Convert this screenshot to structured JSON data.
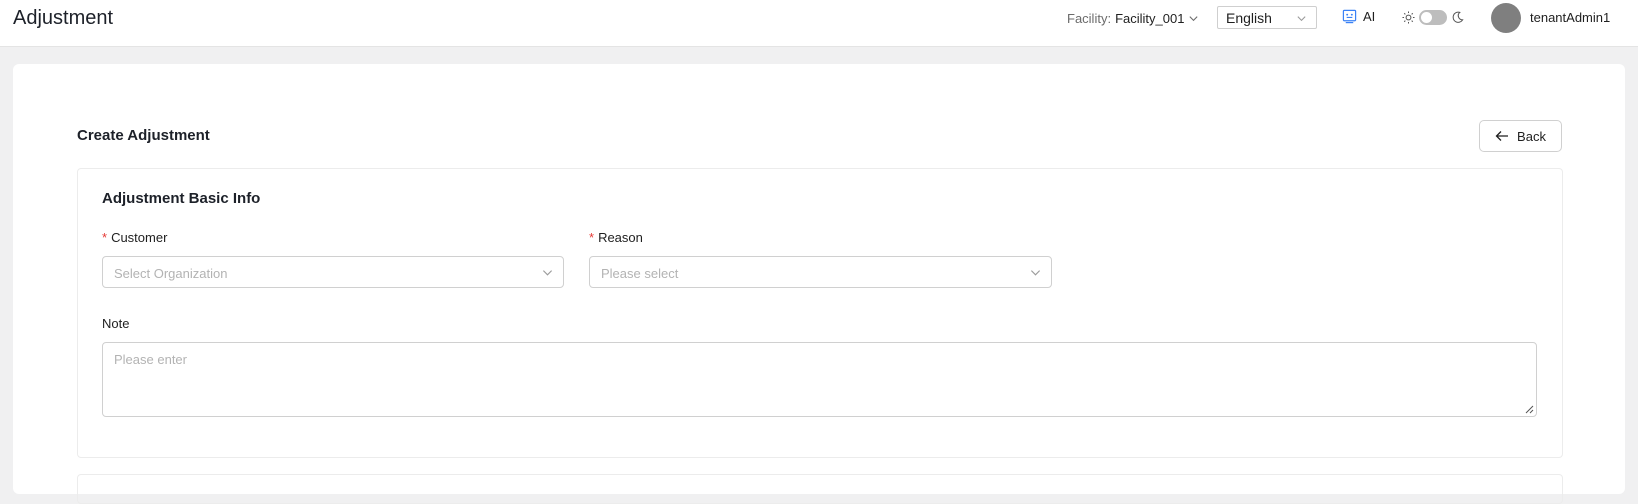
{
  "header": {
    "title": "Adjustment",
    "facility_label": "Facility:",
    "facility_value": "Facility_001",
    "language": "English",
    "ai_label": "AI",
    "username": "tenantAdmin1"
  },
  "page": {
    "title": "Create Adjustment",
    "back_label": "Back"
  },
  "basic_info": {
    "title": "Adjustment Basic Info",
    "customer": {
      "required_mark": "*",
      "label": "Customer",
      "placeholder": "Select Organization"
    },
    "reason": {
      "required_mark": "*",
      "label": "Reason",
      "placeholder": "Please select"
    },
    "note": {
      "label": "Note",
      "placeholder": "Please enter"
    }
  },
  "colors": {
    "required": "#e53935",
    "ai_icon": "#3b82f6",
    "avatar": "#7f7f7f"
  },
  "icons": {
    "ai": "robot-icon",
    "light": "sun-icon",
    "dark": "moon-icon",
    "back": "arrow-left-icon",
    "dropdown": "chevron-down-icon"
  }
}
